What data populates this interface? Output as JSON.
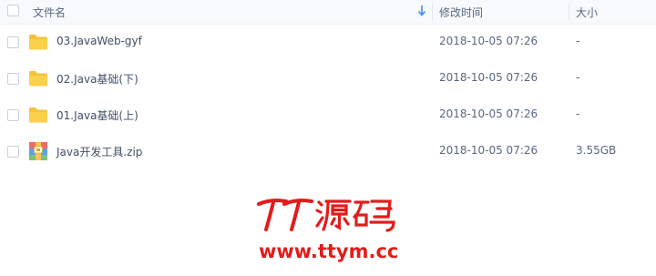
{
  "columns": {
    "name": "文件名",
    "modified": "修改时间",
    "size": "大小"
  },
  "files": [
    {
      "name": "03.JavaWeb-gyf",
      "type": "folder",
      "icon": "folder-icon",
      "modified": "2018-10-05 07:26",
      "size": "-"
    },
    {
      "name": "02.Java基础(下)",
      "type": "folder",
      "icon": "folder-icon",
      "modified": "2018-10-05 07:26",
      "size": "-"
    },
    {
      "name": "01.Java基础(上)",
      "type": "folder",
      "icon": "folder-icon",
      "modified": "2018-10-05 07:26",
      "size": "-"
    },
    {
      "name": "Java开发工具.zip",
      "type": "zip",
      "icon": "zip-archive-icon",
      "modified": "2018-10-05 07:26",
      "size": "3.55GB"
    }
  ],
  "watermark": {
    "logo": "TT源码",
    "url": "www.ttym.cc"
  },
  "colors": {
    "folder": "#f5c33b",
    "accent": "#3b8cff",
    "watermark": "#e31b1b"
  }
}
